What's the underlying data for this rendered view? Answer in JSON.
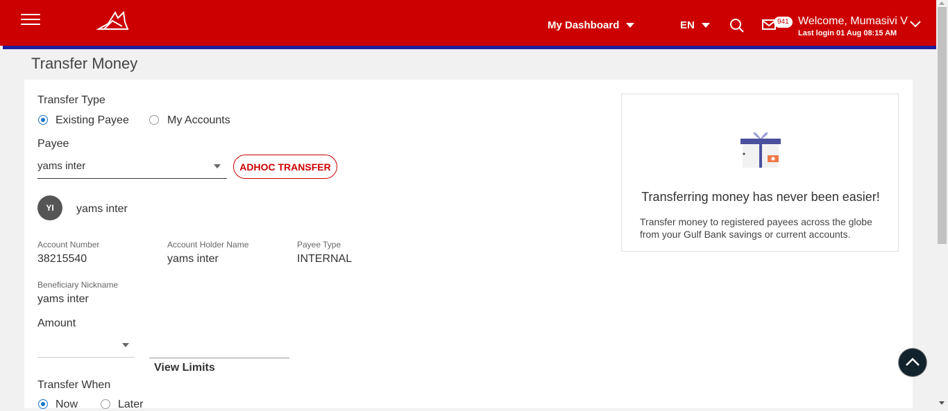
{
  "header": {
    "dashboard_label": "My Dashboard",
    "language": "EN",
    "mail_count": "941",
    "welcome": "Welcome, Mumasivi V",
    "last_login": "Last login 01 Aug 08:15 AM"
  },
  "page": {
    "title": "Transfer Money"
  },
  "form": {
    "transfer_type_label": "Transfer Type",
    "transfer_type_options": [
      "Existing Payee",
      "My Accounts"
    ],
    "transfer_type_selected": "Existing Payee",
    "payee_label": "Payee",
    "payee_value": "yams inter",
    "adhoc_button": "ADHOC TRANSFER",
    "payee_initials": "YI",
    "payee_name": "yams inter",
    "details": {
      "account_number_label": "Account Number",
      "account_number": "38215540",
      "holder_label": "Account Holder Name",
      "holder": "yams inter",
      "payee_type_label": "Payee Type",
      "payee_type": "INTERNAL",
      "nickname_label": "Beneficiary Nickname",
      "nickname": "yams inter"
    },
    "amount_label": "Amount",
    "currency_value": "",
    "amount_value": "",
    "view_limits": "View Limits",
    "transfer_when_label": "Transfer When",
    "transfer_when_options": [
      "Now",
      "Later"
    ],
    "transfer_when_selected": "Now"
  },
  "promo": {
    "title": "Transferring money has never been easier!",
    "text": "Transfer money to registered payees across the globe from your Gulf Bank savings or current accounts."
  },
  "colors": {
    "brand_red": "#cc0000",
    "accent_blue": "#1f1e9c",
    "radio_blue": "#1a73c9"
  }
}
